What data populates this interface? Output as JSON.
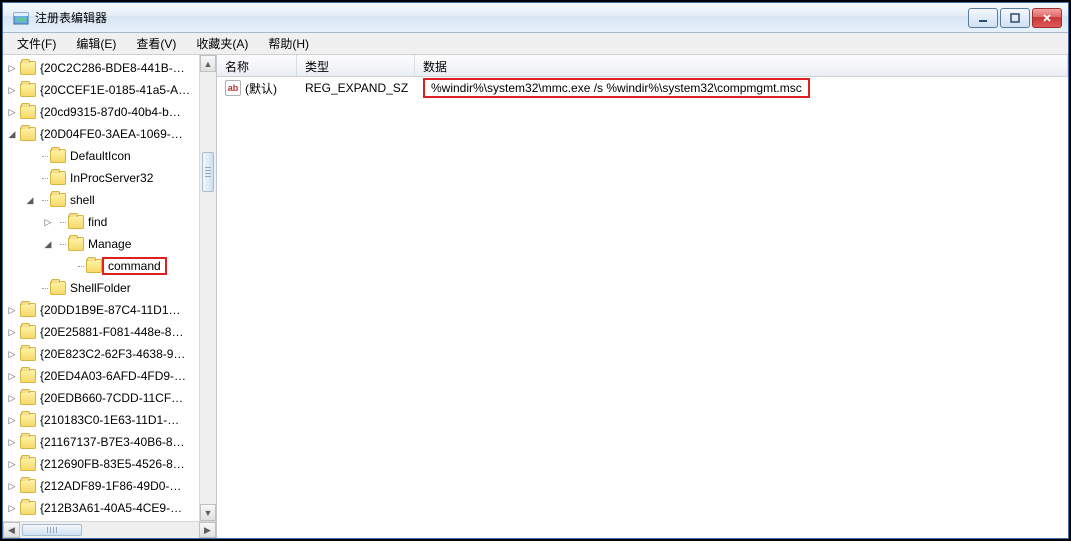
{
  "window": {
    "title": "注册表编辑器"
  },
  "menu": {
    "file": "文件(F)",
    "edit": "编辑(E)",
    "view": "查看(V)",
    "favorites": "收藏夹(A)",
    "help": "帮助(H)"
  },
  "tree": {
    "items": [
      {
        "indent": 0,
        "exp": "▷",
        "label": "{20C2C286-BDE8-441B-…"
      },
      {
        "indent": 0,
        "exp": "▷",
        "label": "{20CCEF1E-0185-41a5-A…"
      },
      {
        "indent": 0,
        "exp": "▷",
        "label": "{20cd9315-87d0-40b4-b…"
      },
      {
        "indent": 0,
        "exp": "◢",
        "label": "{20D04FE0-3AEA-1069-…"
      },
      {
        "indent": 1,
        "exp": "",
        "label": "DefaultIcon"
      },
      {
        "indent": 1,
        "exp": "",
        "label": "InProcServer32"
      },
      {
        "indent": 1,
        "exp": "◢",
        "label": "shell"
      },
      {
        "indent": 2,
        "exp": "▷",
        "label": "find"
      },
      {
        "indent": 2,
        "exp": "◢",
        "label": "Manage"
      },
      {
        "indent": 3,
        "exp": "",
        "label": "command",
        "highlight": true
      },
      {
        "indent": 1,
        "exp": "",
        "label": "ShellFolder"
      },
      {
        "indent": 0,
        "exp": "▷",
        "label": "{20DD1B9E-87C4-11D1…"
      },
      {
        "indent": 0,
        "exp": "▷",
        "label": "{20E25881-F081-448e-8…"
      },
      {
        "indent": 0,
        "exp": "▷",
        "label": "{20E823C2-62F3-4638-9…"
      },
      {
        "indent": 0,
        "exp": "▷",
        "label": "{20ED4A03-6AFD-4FD9-…"
      },
      {
        "indent": 0,
        "exp": "▷",
        "label": "{20EDB660-7CDD-11CF…"
      },
      {
        "indent": 0,
        "exp": "▷",
        "label": "{210183C0-1E63-11D1-…"
      },
      {
        "indent": 0,
        "exp": "▷",
        "label": "{21167137-B7E3-40B6-8…"
      },
      {
        "indent": 0,
        "exp": "▷",
        "label": "{212690FB-83E5-4526-8…"
      },
      {
        "indent": 0,
        "exp": "▷",
        "label": "{212ADF89-1F86-49D0-…"
      },
      {
        "indent": 0,
        "exp": "▷",
        "label": "{212B3A61-40A5-4CE9-…"
      }
    ]
  },
  "list": {
    "columns": {
      "name": "名称",
      "type": "类型",
      "data": "数据"
    },
    "rows": [
      {
        "icon_text": "ab",
        "name": "(默认)",
        "type": "REG_EXPAND_SZ",
        "data": "%windir%\\system32\\mmc.exe /s %windir%\\system32\\compmgmt.msc",
        "data_highlight": true
      }
    ]
  }
}
